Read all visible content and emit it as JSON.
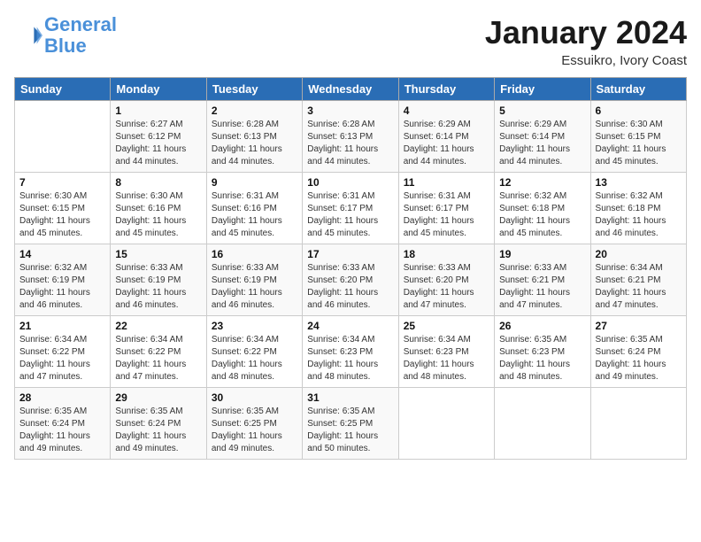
{
  "logo": {
    "line1": "General",
    "line2": "Blue"
  },
  "title": "January 2024",
  "subtitle": "Essuikro, Ivory Coast",
  "weekdays": [
    "Sunday",
    "Monday",
    "Tuesday",
    "Wednesday",
    "Thursday",
    "Friday",
    "Saturday"
  ],
  "weeks": [
    [
      {
        "day": "",
        "info": ""
      },
      {
        "day": "1",
        "info": "Sunrise: 6:27 AM\nSunset: 6:12 PM\nDaylight: 11 hours and 44 minutes."
      },
      {
        "day": "2",
        "info": "Sunrise: 6:28 AM\nSunset: 6:13 PM\nDaylight: 11 hours and 44 minutes."
      },
      {
        "day": "3",
        "info": "Sunrise: 6:28 AM\nSunset: 6:13 PM\nDaylight: 11 hours and 44 minutes."
      },
      {
        "day": "4",
        "info": "Sunrise: 6:29 AM\nSunset: 6:14 PM\nDaylight: 11 hours and 44 minutes."
      },
      {
        "day": "5",
        "info": "Sunrise: 6:29 AM\nSunset: 6:14 PM\nDaylight: 11 hours and 44 minutes."
      },
      {
        "day": "6",
        "info": "Sunrise: 6:30 AM\nSunset: 6:15 PM\nDaylight: 11 hours and 45 minutes."
      }
    ],
    [
      {
        "day": "7",
        "info": "Sunrise: 6:30 AM\nSunset: 6:15 PM\nDaylight: 11 hours and 45 minutes."
      },
      {
        "day": "8",
        "info": "Sunrise: 6:30 AM\nSunset: 6:16 PM\nDaylight: 11 hours and 45 minutes."
      },
      {
        "day": "9",
        "info": "Sunrise: 6:31 AM\nSunset: 6:16 PM\nDaylight: 11 hours and 45 minutes."
      },
      {
        "day": "10",
        "info": "Sunrise: 6:31 AM\nSunset: 6:17 PM\nDaylight: 11 hours and 45 minutes."
      },
      {
        "day": "11",
        "info": "Sunrise: 6:31 AM\nSunset: 6:17 PM\nDaylight: 11 hours and 45 minutes."
      },
      {
        "day": "12",
        "info": "Sunrise: 6:32 AM\nSunset: 6:18 PM\nDaylight: 11 hours and 45 minutes."
      },
      {
        "day": "13",
        "info": "Sunrise: 6:32 AM\nSunset: 6:18 PM\nDaylight: 11 hours and 46 minutes."
      }
    ],
    [
      {
        "day": "14",
        "info": "Sunrise: 6:32 AM\nSunset: 6:19 PM\nDaylight: 11 hours and 46 minutes."
      },
      {
        "day": "15",
        "info": "Sunrise: 6:33 AM\nSunset: 6:19 PM\nDaylight: 11 hours and 46 minutes."
      },
      {
        "day": "16",
        "info": "Sunrise: 6:33 AM\nSunset: 6:19 PM\nDaylight: 11 hours and 46 minutes."
      },
      {
        "day": "17",
        "info": "Sunrise: 6:33 AM\nSunset: 6:20 PM\nDaylight: 11 hours and 46 minutes."
      },
      {
        "day": "18",
        "info": "Sunrise: 6:33 AM\nSunset: 6:20 PM\nDaylight: 11 hours and 47 minutes."
      },
      {
        "day": "19",
        "info": "Sunrise: 6:33 AM\nSunset: 6:21 PM\nDaylight: 11 hours and 47 minutes."
      },
      {
        "day": "20",
        "info": "Sunrise: 6:34 AM\nSunset: 6:21 PM\nDaylight: 11 hours and 47 minutes."
      }
    ],
    [
      {
        "day": "21",
        "info": "Sunrise: 6:34 AM\nSunset: 6:22 PM\nDaylight: 11 hours and 47 minutes."
      },
      {
        "day": "22",
        "info": "Sunrise: 6:34 AM\nSunset: 6:22 PM\nDaylight: 11 hours and 47 minutes."
      },
      {
        "day": "23",
        "info": "Sunrise: 6:34 AM\nSunset: 6:22 PM\nDaylight: 11 hours and 48 minutes."
      },
      {
        "day": "24",
        "info": "Sunrise: 6:34 AM\nSunset: 6:23 PM\nDaylight: 11 hours and 48 minutes."
      },
      {
        "day": "25",
        "info": "Sunrise: 6:34 AM\nSunset: 6:23 PM\nDaylight: 11 hours and 48 minutes."
      },
      {
        "day": "26",
        "info": "Sunrise: 6:35 AM\nSunset: 6:23 PM\nDaylight: 11 hours and 48 minutes."
      },
      {
        "day": "27",
        "info": "Sunrise: 6:35 AM\nSunset: 6:24 PM\nDaylight: 11 hours and 49 minutes."
      }
    ],
    [
      {
        "day": "28",
        "info": "Sunrise: 6:35 AM\nSunset: 6:24 PM\nDaylight: 11 hours and 49 minutes."
      },
      {
        "day": "29",
        "info": "Sunrise: 6:35 AM\nSunset: 6:24 PM\nDaylight: 11 hours and 49 minutes."
      },
      {
        "day": "30",
        "info": "Sunrise: 6:35 AM\nSunset: 6:25 PM\nDaylight: 11 hours and 49 minutes."
      },
      {
        "day": "31",
        "info": "Sunrise: 6:35 AM\nSunset: 6:25 PM\nDaylight: 11 hours and 50 minutes."
      },
      {
        "day": "",
        "info": ""
      },
      {
        "day": "",
        "info": ""
      },
      {
        "day": "",
        "info": ""
      }
    ]
  ]
}
